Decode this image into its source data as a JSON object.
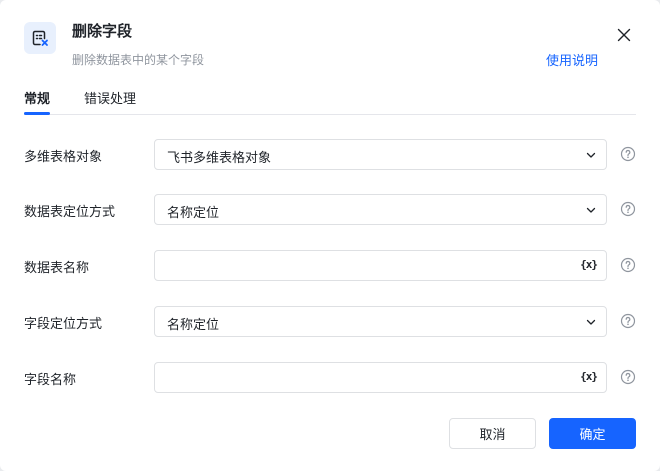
{
  "dialog": {
    "icon": "delete-field-icon",
    "title": "删除字段",
    "subtitle": "删除数据表中的某个字段",
    "help_link": "使用说明",
    "close_icon": "close-icon"
  },
  "tabs": [
    {
      "label": "常规",
      "active": true
    },
    {
      "label": "错误处理",
      "active": false
    }
  ],
  "form": {
    "rows": [
      {
        "label": "多维表格对象",
        "type": "select",
        "value": "飞书多维表格对象"
      },
      {
        "label": "数据表定位方式",
        "type": "select",
        "value": "名称定位"
      },
      {
        "label": "数据表名称",
        "type": "input",
        "value": "",
        "var_button": "{x}"
      },
      {
        "label": "字段定位方式",
        "type": "select",
        "value": "名称定位"
      },
      {
        "label": "字段名称",
        "type": "input",
        "value": "",
        "var_button": "{x}"
      }
    ]
  },
  "footer": {
    "cancel_label": "取消",
    "confirm_label": "确定"
  },
  "colors": {
    "accent": "#1664ff",
    "border": "#dee0e3",
    "muted_text": "#8f959e"
  }
}
